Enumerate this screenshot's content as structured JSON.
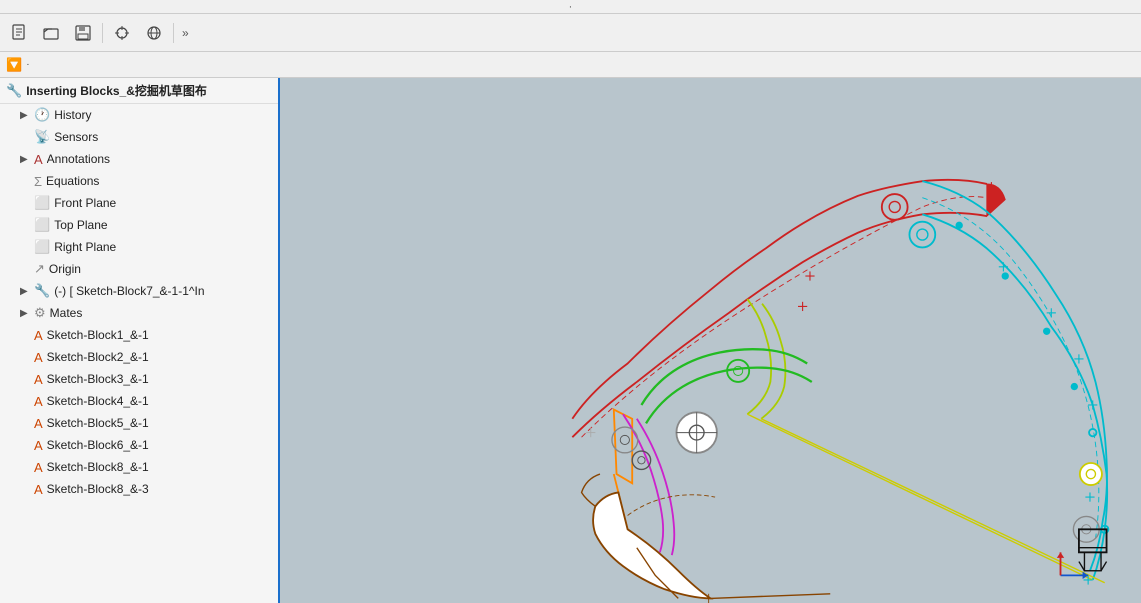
{
  "topbar": {
    "dot": "·"
  },
  "toolbar": {
    "buttons": [
      {
        "name": "new-icon",
        "symbol": "🖹",
        "label": "New"
      },
      {
        "name": "open-icon",
        "symbol": "📄",
        "label": "Open"
      },
      {
        "name": "save-icon",
        "symbol": "💾",
        "label": "Save"
      },
      {
        "name": "crosshair-icon",
        "symbol": "⊕",
        "label": "Center"
      },
      {
        "name": "globe-icon",
        "symbol": "🌐",
        "label": "Globe"
      }
    ],
    "more_label": "»"
  },
  "filter": {
    "icon": "🔽",
    "separator": "·"
  },
  "sidebar": {
    "doc_icon": "🔧",
    "doc_title": "Inserting Blocks_&挖掘机草图布",
    "items": [
      {
        "id": "history",
        "indent": 1,
        "arrow": "▶",
        "icon": "🕐",
        "icon_class": "icon-history",
        "label": "History"
      },
      {
        "id": "sensors",
        "indent": 1,
        "arrow": "",
        "icon": "📡",
        "icon_class": "icon-sensor",
        "label": "Sensors"
      },
      {
        "id": "annotations",
        "indent": 1,
        "arrow": "▶",
        "icon": "A",
        "icon_class": "icon-annotation",
        "label": "Annotations"
      },
      {
        "id": "equations",
        "indent": 1,
        "arrow": "",
        "icon": "Σ",
        "icon_class": "icon-equation",
        "label": "Equations"
      },
      {
        "id": "front-plane",
        "indent": 1,
        "arrow": "",
        "icon": "⬜",
        "icon_class": "icon-plane",
        "label": "Front Plane"
      },
      {
        "id": "top-plane",
        "indent": 1,
        "arrow": "",
        "icon": "⬜",
        "icon_class": "icon-plane",
        "label": "Top Plane"
      },
      {
        "id": "right-plane",
        "indent": 1,
        "arrow": "",
        "icon": "⬜",
        "icon_class": "icon-plane",
        "label": "Right Plane"
      },
      {
        "id": "origin",
        "indent": 1,
        "arrow": "",
        "icon": "↗",
        "icon_class": "icon-origin",
        "label": "Origin"
      },
      {
        "id": "assembly",
        "indent": 1,
        "arrow": "▶",
        "icon": "🔧",
        "icon_class": "icon-part",
        "label": "(-) [ Sketch-Block7_&-1-1^In"
      },
      {
        "id": "mates",
        "indent": 1,
        "arrow": "▶",
        "icon": "⚙",
        "icon_class": "icon-mates",
        "label": "Mates"
      },
      {
        "id": "sketch-block1",
        "indent": 1,
        "arrow": "",
        "icon": "A",
        "icon_class": "icon-sketch",
        "label": "Sketch-Block1_&-1"
      },
      {
        "id": "sketch-block2",
        "indent": 1,
        "arrow": "",
        "icon": "A",
        "icon_class": "icon-sketch",
        "label": "Sketch-Block2_&-1"
      },
      {
        "id": "sketch-block3",
        "indent": 1,
        "arrow": "",
        "icon": "A",
        "icon_class": "icon-sketch",
        "label": "Sketch-Block3_&-1"
      },
      {
        "id": "sketch-block4",
        "indent": 1,
        "arrow": "",
        "icon": "A",
        "icon_class": "icon-sketch",
        "label": "Sketch-Block4_&-1"
      },
      {
        "id": "sketch-block5",
        "indent": 1,
        "arrow": "",
        "icon": "A",
        "icon_class": "icon-sketch",
        "label": "Sketch-Block5_&-1"
      },
      {
        "id": "sketch-block6",
        "indent": 1,
        "arrow": "",
        "icon": "A",
        "icon_class": "icon-sketch",
        "label": "Sketch-Block6_&-1"
      },
      {
        "id": "sketch-block8a",
        "indent": 1,
        "arrow": "",
        "icon": "A",
        "icon_class": "icon-sketch",
        "label": "Sketch-Block8_&-1"
      },
      {
        "id": "sketch-block8b",
        "indent": 1,
        "arrow": "",
        "icon": "A",
        "icon_class": "icon-sketch",
        "label": "Sketch-Block8_&-3"
      }
    ]
  },
  "viewport": {
    "bg_color": "#b8c5cc",
    "star_color": "#1155cc"
  }
}
